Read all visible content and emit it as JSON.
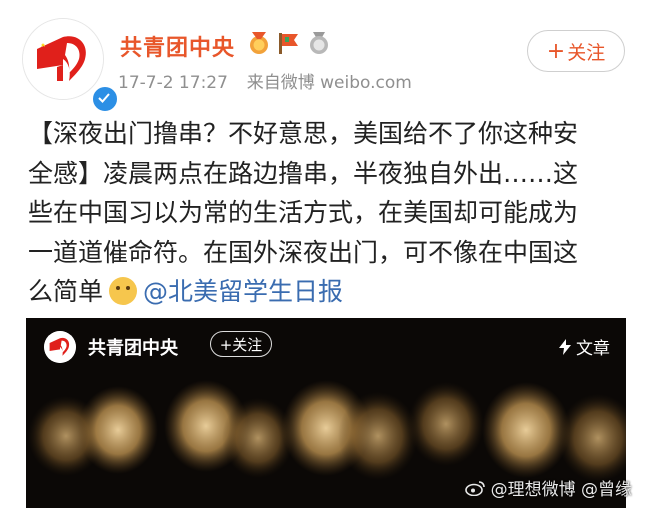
{
  "post": {
    "author": "共青团中央",
    "timestamp": "17-7-2 17:27",
    "source_prefix": "来自",
    "source": "微博 weibo.com",
    "follow_label": "关注",
    "follow_plus": "+",
    "text_line1": "【深夜出门撸串？不好意思，美国给不了你这种安",
    "text_line2": "全感】凌晨两点在路边撸串，半夜独自外出……这",
    "text_line3": "些在中国习以为常的生活方式，在美国却可能成为",
    "text_line4": "一道道催命符。在国外深夜出门，可不像在中国这",
    "text_line5": "么简单",
    "mention": "@北美留学生日报",
    "badges": [
      "medal-icon",
      "flag-icon",
      "silver-medal-icon"
    ]
  },
  "card": {
    "author": "共青团中央",
    "follow_label": "+关注",
    "type_label": "文章"
  },
  "watermark": {
    "text": "@理想微博 @曾缘"
  },
  "colors": {
    "author": "#e8562a",
    "mention": "#3a6cb0",
    "verified": "#2c8fe5"
  }
}
